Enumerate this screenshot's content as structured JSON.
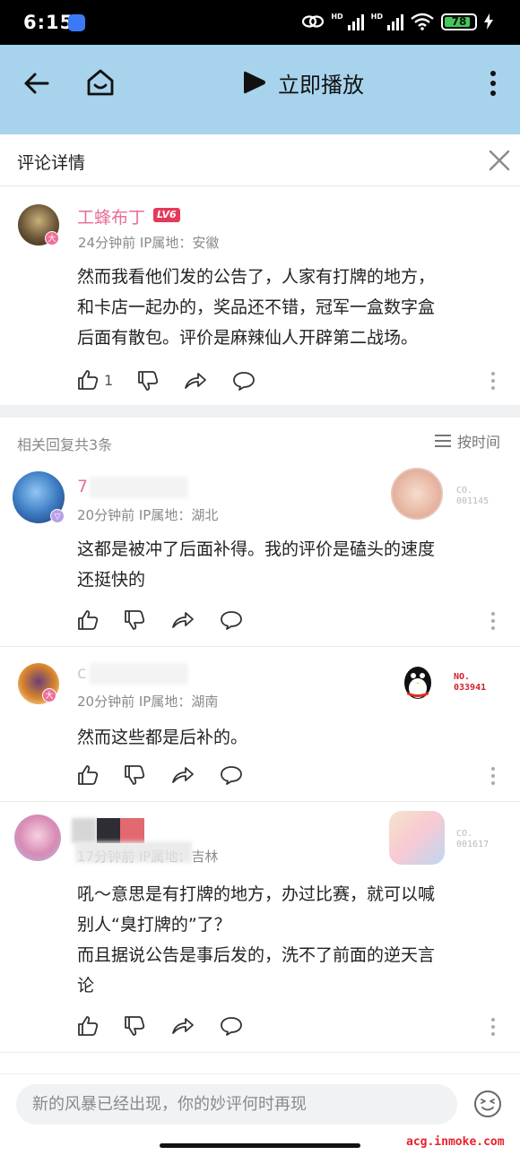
{
  "status_bar": {
    "time": "6:15",
    "battery": "78",
    "signal_labels": [
      "HD",
      "HD"
    ]
  },
  "top_bar": {
    "play_label": "立即播放",
    "icons": [
      "back-arrow-icon",
      "home-icon",
      "play-icon",
      "more-vertical-icon"
    ],
    "background_color": "#a8d3ec"
  },
  "detail": {
    "title": "评论详情"
  },
  "main_comment": {
    "username": "工蜂布丁",
    "level": "LV6",
    "meta": "24分钟前  IP属地：安徽",
    "text": "然而我看他们发的公告了，人家有打牌的地方，\n和卡店一起办的，奖品还不错，冠军一盒数字盒\n后面有散包。评价是麻辣仙人开辟第二战场。",
    "like_count": "1",
    "username_color": "#e96c9a"
  },
  "replies_header": {
    "count_label": "相关回复共3条",
    "sort_label": "按时间"
  },
  "replies": [
    {
      "username": "7",
      "meta": "20分钟前  IP属地：湖北",
      "text": "这都是被冲了后面补得。我的评价是磕头的速度\n还挺快的",
      "deco_no": "CO.\n001145"
    },
    {
      "username": "c",
      "meta": "20分钟前  IP属地：湖南",
      "text": "然而这些都是后补的。",
      "deco_no": "NO.\n033941"
    },
    {
      "username": "",
      "meta": "17分钟前  IP属地：吉林",
      "text": "吼～意思是有打牌的地方，办过比赛，就可以喊\n别人“臭打牌的”了？\n而且据说公告是事后发的，洗不了前面的逆天言\n论",
      "deco_no": "CO.\n001617"
    }
  ],
  "bottom": {
    "input_placeholder": "新的风暴已经出现，你的妙评何时再现",
    "watermark": "acg.inmoke.com"
  }
}
